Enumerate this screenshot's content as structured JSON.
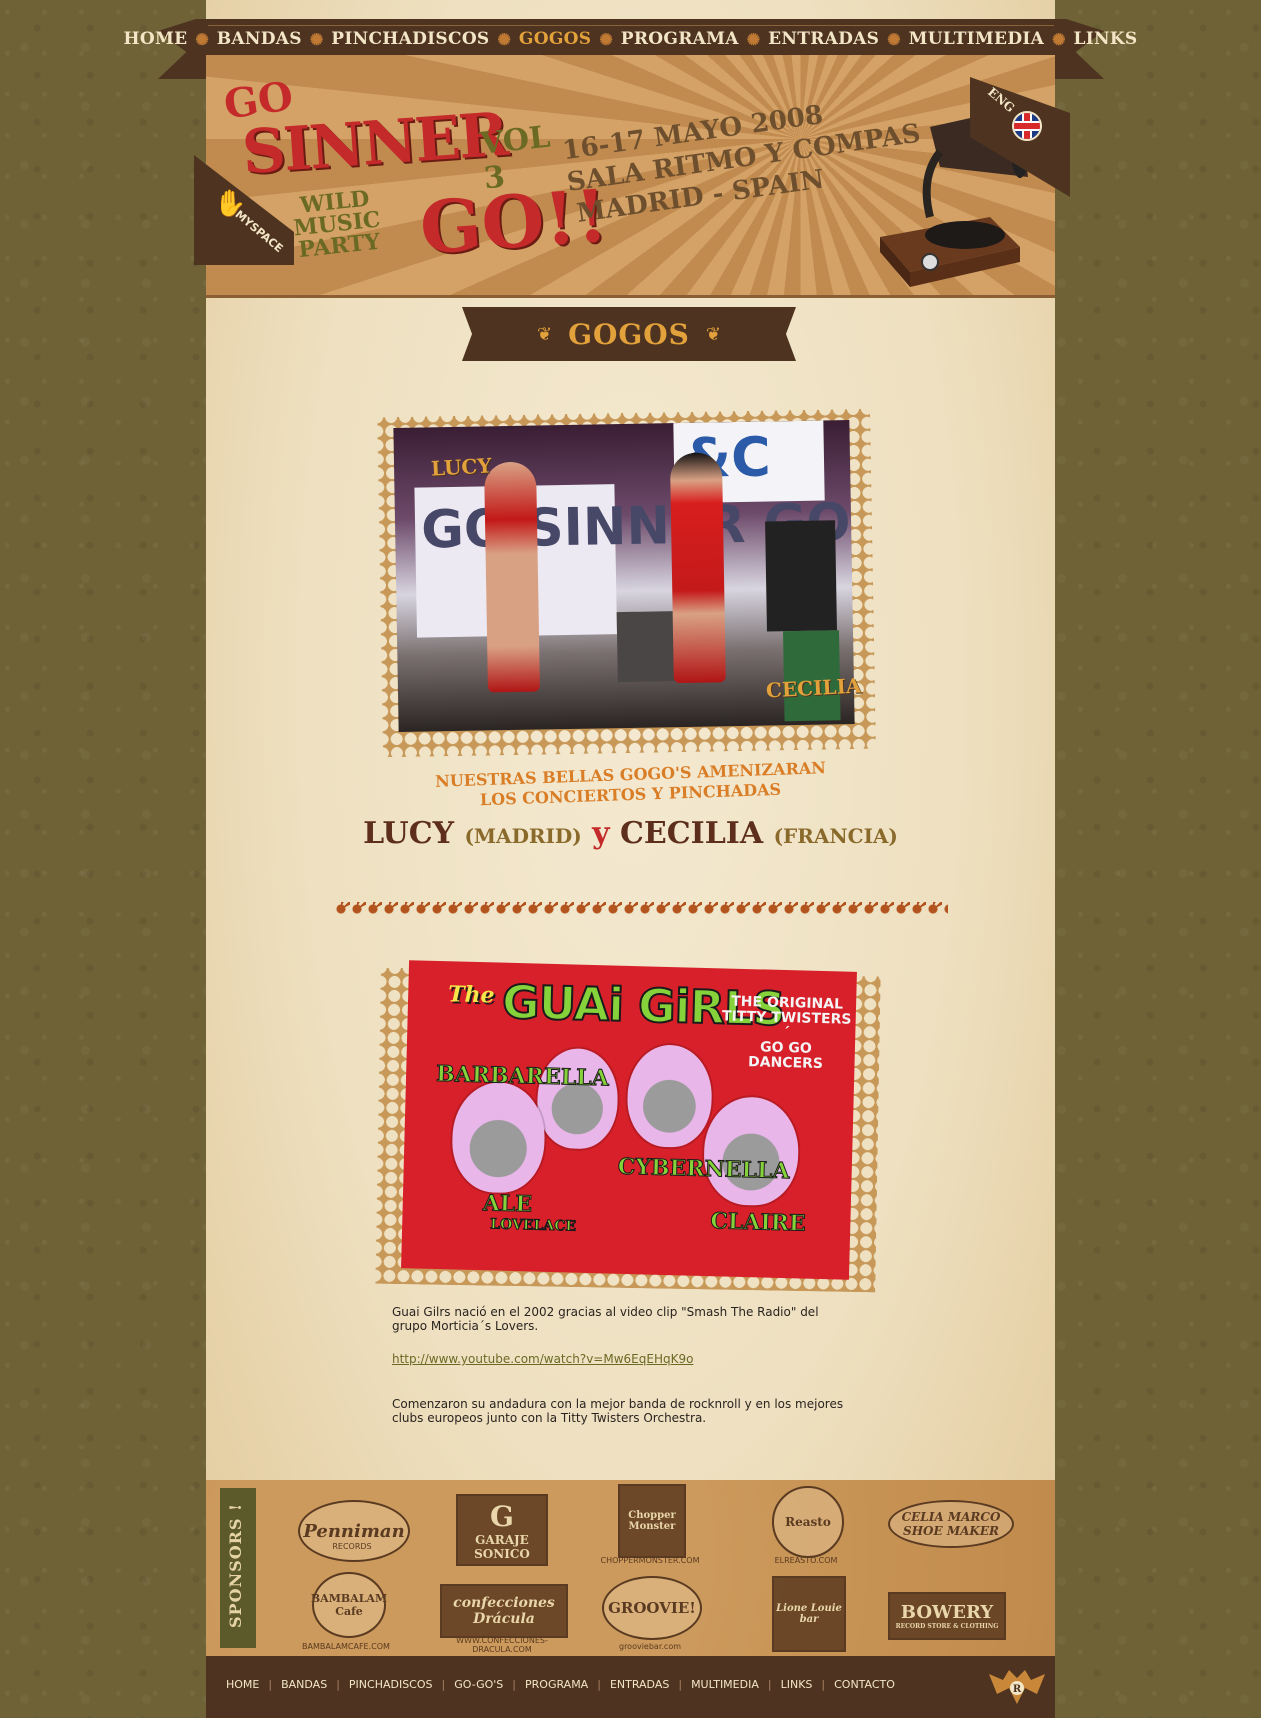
{
  "nav": {
    "items": [
      "HOME",
      "BANDAS",
      "PINCHADISCOS",
      "GOGOS",
      "PROGRAMA",
      "ENTRADAS",
      "MULTIMEDIA",
      "LINKS"
    ],
    "active": "GOGOS"
  },
  "header": {
    "logo": {
      "go1": "GO",
      "sinner": "SINNER",
      "vol": "VOL 3",
      "wild": "WILD MUSIC",
      "party": "PARTY",
      "go2": "GO!!"
    },
    "date": "16-17 MAYO 2008",
    "venue": "SALA RITMO Y COMPAS",
    "city": "MADRID - SPAIN",
    "myspace_label": "MYSPACE",
    "lang_label": "ENG"
  },
  "section": {
    "title": "GOGOS"
  },
  "photo1": {
    "label_left": "LUCY",
    "label_right": "CECILIA",
    "stage_text": "GO SINNER GO",
    "sign_text": "&C"
  },
  "intro": {
    "line1": "NUESTRAS BELLAS GOGO'S AMENIZARAN",
    "line2": "LOS CONCIERTOS Y PINCHADAS",
    "name1": "LUCY",
    "place1": "(MADRID)",
    "and": "y",
    "name2": "CECILIA",
    "place2": "(FRANCIA)"
  },
  "poster": {
    "the": "The",
    "title": "GUAi GiRLS",
    "tagline1": "THE ORIGINAL",
    "tagline2": "TITTY TWISTERS´",
    "tagline3": "GO GO DANCERS",
    "names": {
      "barbarella": "BARBARELLA",
      "ale": "ALE",
      "ale2": "LOVELACE",
      "cybernella": "CYBERNELLA",
      "claire": "CLAIRE"
    }
  },
  "body": {
    "p1": "Guai Gilrs nació en el 2002 gracias al video clip \"Smash The Radio\" del grupo Morticia´s Lovers.",
    "link": "http://www.youtube.com/watch?v=Mw6EqEHqK9o",
    "p2": "Comenzaron su andadura con la mejor banda de rocknroll y en los mejores clubs europeos junto con la Titty Twisters Orchestra."
  },
  "sponsors": {
    "label": "SPONSORS !",
    "items": [
      {
        "name": "Penniman",
        "sub": "RECORDS"
      },
      {
        "name": "GARAJE SONICO",
        "sub": "G"
      },
      {
        "name": "Chopper Monster",
        "sub": "CHOPPERMONSTER.COM"
      },
      {
        "name": "Reasto",
        "sub": "ELREASTO.COM"
      },
      {
        "name": "CELIA MARCO SHOE MAKER",
        "sub": ""
      },
      {
        "name": "BAMBALAM Cafe",
        "sub": "BAMBALAMCAFE.COM"
      },
      {
        "name": "confecciones Drácula",
        "sub": "WWW.CONFECCIONES-DRACULA.COM"
      },
      {
        "name": "GROOVIE!",
        "sub": "grooviebar.com"
      },
      {
        "name": "Lione Louie bar",
        "sub": ""
      },
      {
        "name": "BOWERY",
        "sub": "RECORD STORE & CLOTHING"
      }
    ]
  },
  "footer": {
    "items": [
      "HOME",
      "BANDAS",
      "PINCHADISCOS",
      "GO-GO'S",
      "PROGRAMA",
      "ENTRADAS",
      "MULTIMEDIA",
      "LINKS",
      "CONTACTO"
    ]
  },
  "colors": {
    "brown_dark": "#4e3420",
    "accent_orange": "#e3a13b",
    "red": "#c42a2a",
    "olive": "#6b6a24",
    "paper": "#efe1c2"
  }
}
